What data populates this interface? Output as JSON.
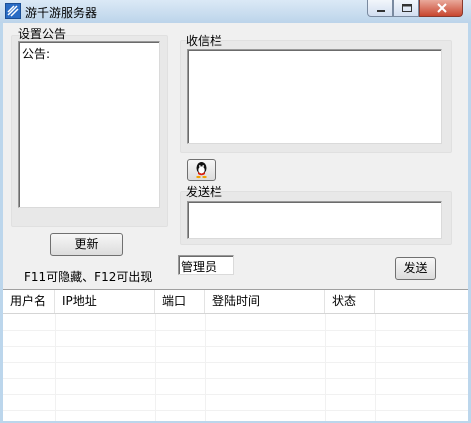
{
  "window": {
    "title": "游千游服务器"
  },
  "announcement": {
    "group_label": "设置公告",
    "text": "公告:",
    "update_button": "更新"
  },
  "hotkey_hint": "F11可隐藏、F12可出现",
  "inbox": {
    "group_label": "收信栏"
  },
  "send": {
    "group_label": "发送栏",
    "sender_value": "管理员",
    "send_button": "发送"
  },
  "table": {
    "columns": [
      "用户名",
      "IP地址",
      "端口",
      "登陆时间",
      "状态"
    ]
  },
  "colors": {
    "titlebar": "#bcd4ea",
    "close_button": "#c8462f",
    "client_bg": "#f0f0f0"
  },
  "icons": {
    "app": "app-icon",
    "qq": "qq-penguin-icon"
  }
}
